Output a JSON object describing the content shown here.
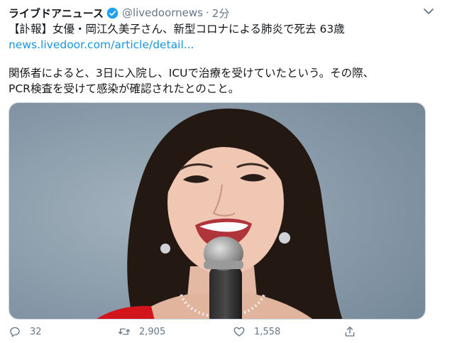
{
  "tweet": {
    "display_name": "ライブドアニュース",
    "handle": "@livedoornews",
    "separator": "·",
    "time": "2分",
    "headline": "【訃報】女優・岡江久美子さん、新型コロナによる肺炎で死去 63歳",
    "link": "news.livedoor.com/article/detail...",
    "body_line1": "関係者によると、3日に入院し、ICUで治療を受けていたという。その際、",
    "body_line2": "PCR検査を受けて感染が確認されたとのこと。"
  },
  "actions": {
    "reply_count": "32",
    "retweet_count": "2,905",
    "like_count": "1,558"
  },
  "icons": [
    "verified-badge-icon",
    "caret-down-icon",
    "reply-icon",
    "retweet-icon",
    "like-icon",
    "share-icon"
  ],
  "colors": {
    "link": "#1b95e0",
    "verified": "#1da1f2",
    "muted": "#657786",
    "photo_background": "#8fa0ae",
    "dress": "#d2151d"
  }
}
